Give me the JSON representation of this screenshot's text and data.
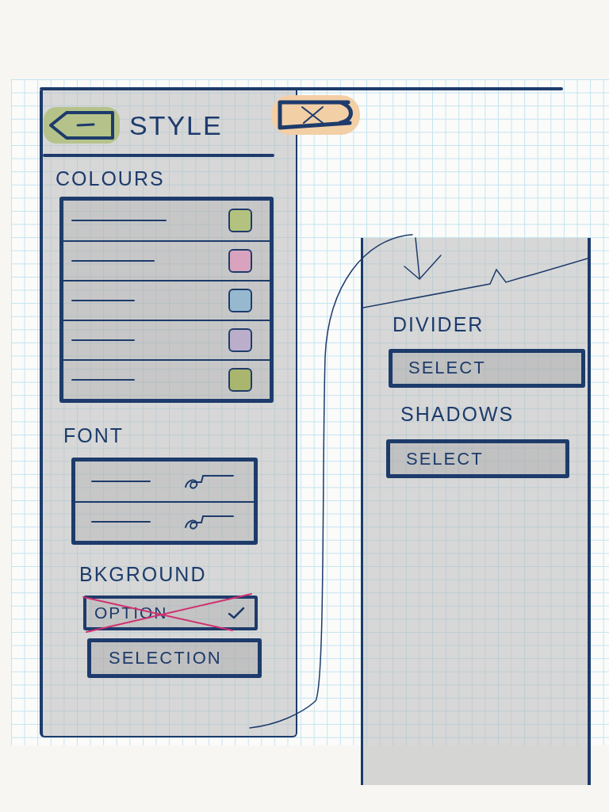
{
  "style_panel": {
    "title": "STYLE",
    "colours": {
      "label": "COLOURS",
      "rows": [
        {
          "color": "#b3c27e"
        },
        {
          "color": "#d9a3bd"
        },
        {
          "color": "#96b9cf"
        },
        {
          "color": "#bbaecb"
        },
        {
          "color": "#aab56e"
        }
      ]
    },
    "font": {
      "label": "FONT",
      "rows": [
        {
          "kind": "sample"
        },
        {
          "kind": "sample"
        }
      ]
    },
    "background": {
      "label": "BKGROUND",
      "option": {
        "label": "OPTION",
        "crossed_out": true,
        "checked": true
      },
      "select": {
        "value": "SELECTION"
      }
    }
  },
  "detail_panel": {
    "sections": [
      {
        "label": "DIVIDER",
        "select": {
          "value": "SELECT"
        }
      },
      {
        "label": "SHADOWS",
        "select": {
          "value": "SELECT"
        }
      }
    ]
  }
}
